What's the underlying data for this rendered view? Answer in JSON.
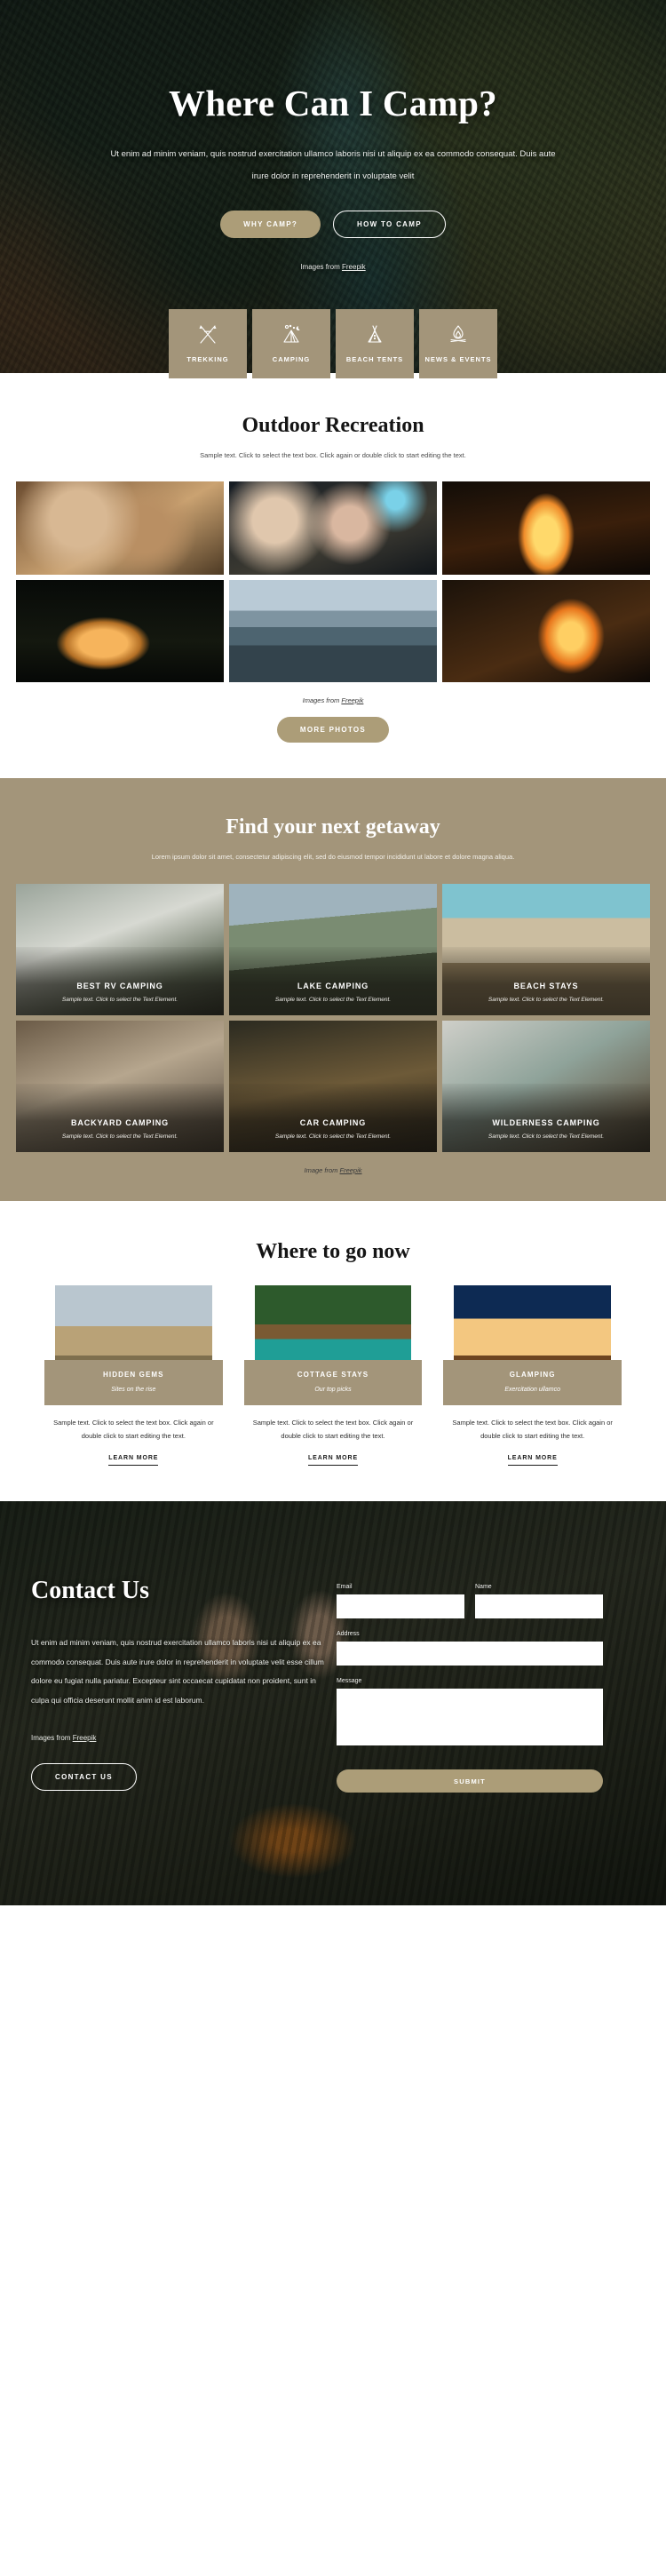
{
  "hero": {
    "title": "Where Can I Camp?",
    "subtitle": "Ut enim ad minim veniam, quis nostrud exercitation ullamco laboris nisi ut aliquip ex ea commodo consequat. Duis aute irure dolor in reprehenderit in voluptate velit",
    "primary_button": "WHY CAMP?",
    "secondary_button": "HOW TO CAMP",
    "credit_prefix": "Images from ",
    "credit_link": "Freepik"
  },
  "tiles": [
    {
      "label": "TREKKING",
      "icon": "crossed-poles-icon"
    },
    {
      "label": "CAMPING",
      "icon": "tent-night-icon"
    },
    {
      "label": "BEACH TENTS",
      "icon": "teepee-icon"
    },
    {
      "label": "NEWS & EVENTS",
      "icon": "campfire-icon"
    }
  ],
  "recreation": {
    "title": "Outdoor Recreation",
    "subtitle": "Sample text. Click to select the text box. Click again or double click to start editing the text.",
    "photos": [
      {
        "name": "friends-cooking-photo"
      },
      {
        "name": "couple-string-lights-photo"
      },
      {
        "name": "campfire-flames-photo"
      },
      {
        "name": "lit-tent-night-photo"
      },
      {
        "name": "mountain-river-photo"
      },
      {
        "name": "couple-bonfire-photo"
      }
    ],
    "credit_prefix": "Images from ",
    "credit_link": "Freepik",
    "more_button": "MORE PHOTOS"
  },
  "getaway": {
    "title": "Find your next getaway",
    "subtitle": "Lorem ipsum dolor sit amet, consectetur adipiscing elit, sed do eiusmod tempor incididunt ut labore et dolore magna aliqua.",
    "cards": [
      {
        "title": "BEST RV CAMPING",
        "sub": "Sample text. Click to select the Text Element."
      },
      {
        "title": "LAKE CAMPING",
        "sub": "Sample text. Click to select the Text Element."
      },
      {
        "title": "BEACH STAYS",
        "sub": "Sample text. Click to select the Text Element."
      },
      {
        "title": "BACKYARD CAMPING",
        "sub": "Sample text. Click to select the Text Element."
      },
      {
        "title": "CAR CAMPING",
        "sub": "Sample text. Click to select the Text Element."
      },
      {
        "title": "WILDERNESS CAMPING",
        "sub": "Sample text. Click to select the Text Element."
      }
    ],
    "credit_prefix": "Image from ",
    "credit_link": "Freepik"
  },
  "where_to_go": {
    "title": "Where to go now",
    "cards": [
      {
        "plaque_title": "HIDDEN GEMS",
        "plaque_sub": "Sites on the rise",
        "desc": "Sample text. Click to select the text box. Click again or double click to start editing the text.",
        "link": "LEARN MORE"
      },
      {
        "plaque_title": "COTTAGE STAYS",
        "plaque_sub": "Our top picks",
        "desc": "Sample text. Click to select the text box. Click again or double click to start editing the text.",
        "link": "LEARN MORE"
      },
      {
        "plaque_title": "GLAMPING",
        "plaque_sub": "Exercitation ullamco",
        "desc": "Sample text. Click to select the text box. Click again or double click to start editing the text.",
        "link": "LEARN MORE"
      }
    ]
  },
  "contact": {
    "title": "Contact Us",
    "body": "Ut enim ad minim veniam, quis nostrud exercitation ullamco laboris nisi ut aliquip ex ea commodo consequat. Duis aute irure dolor in reprehenderit in voluptate velit esse cillum dolore eu fugiat nulla pariatur. Excepteur sint occaecat cupidatat non proident, sunt in culpa qui officia deserunt mollit anim id est laborum.",
    "credit_prefix": "Images from ",
    "credit_link": "Freepik",
    "button": "CONTACT US",
    "form": {
      "email_label": "Email",
      "email_value": "",
      "name_label": "Name",
      "name_value": "",
      "address_label": "Address",
      "address_value": "",
      "message_label": "Message",
      "message_value": "",
      "submit": "SUBMIT"
    }
  },
  "colors": {
    "tan": "#a3957a",
    "tan_button": "#ac9d78",
    "dark": "#1b1d17"
  }
}
